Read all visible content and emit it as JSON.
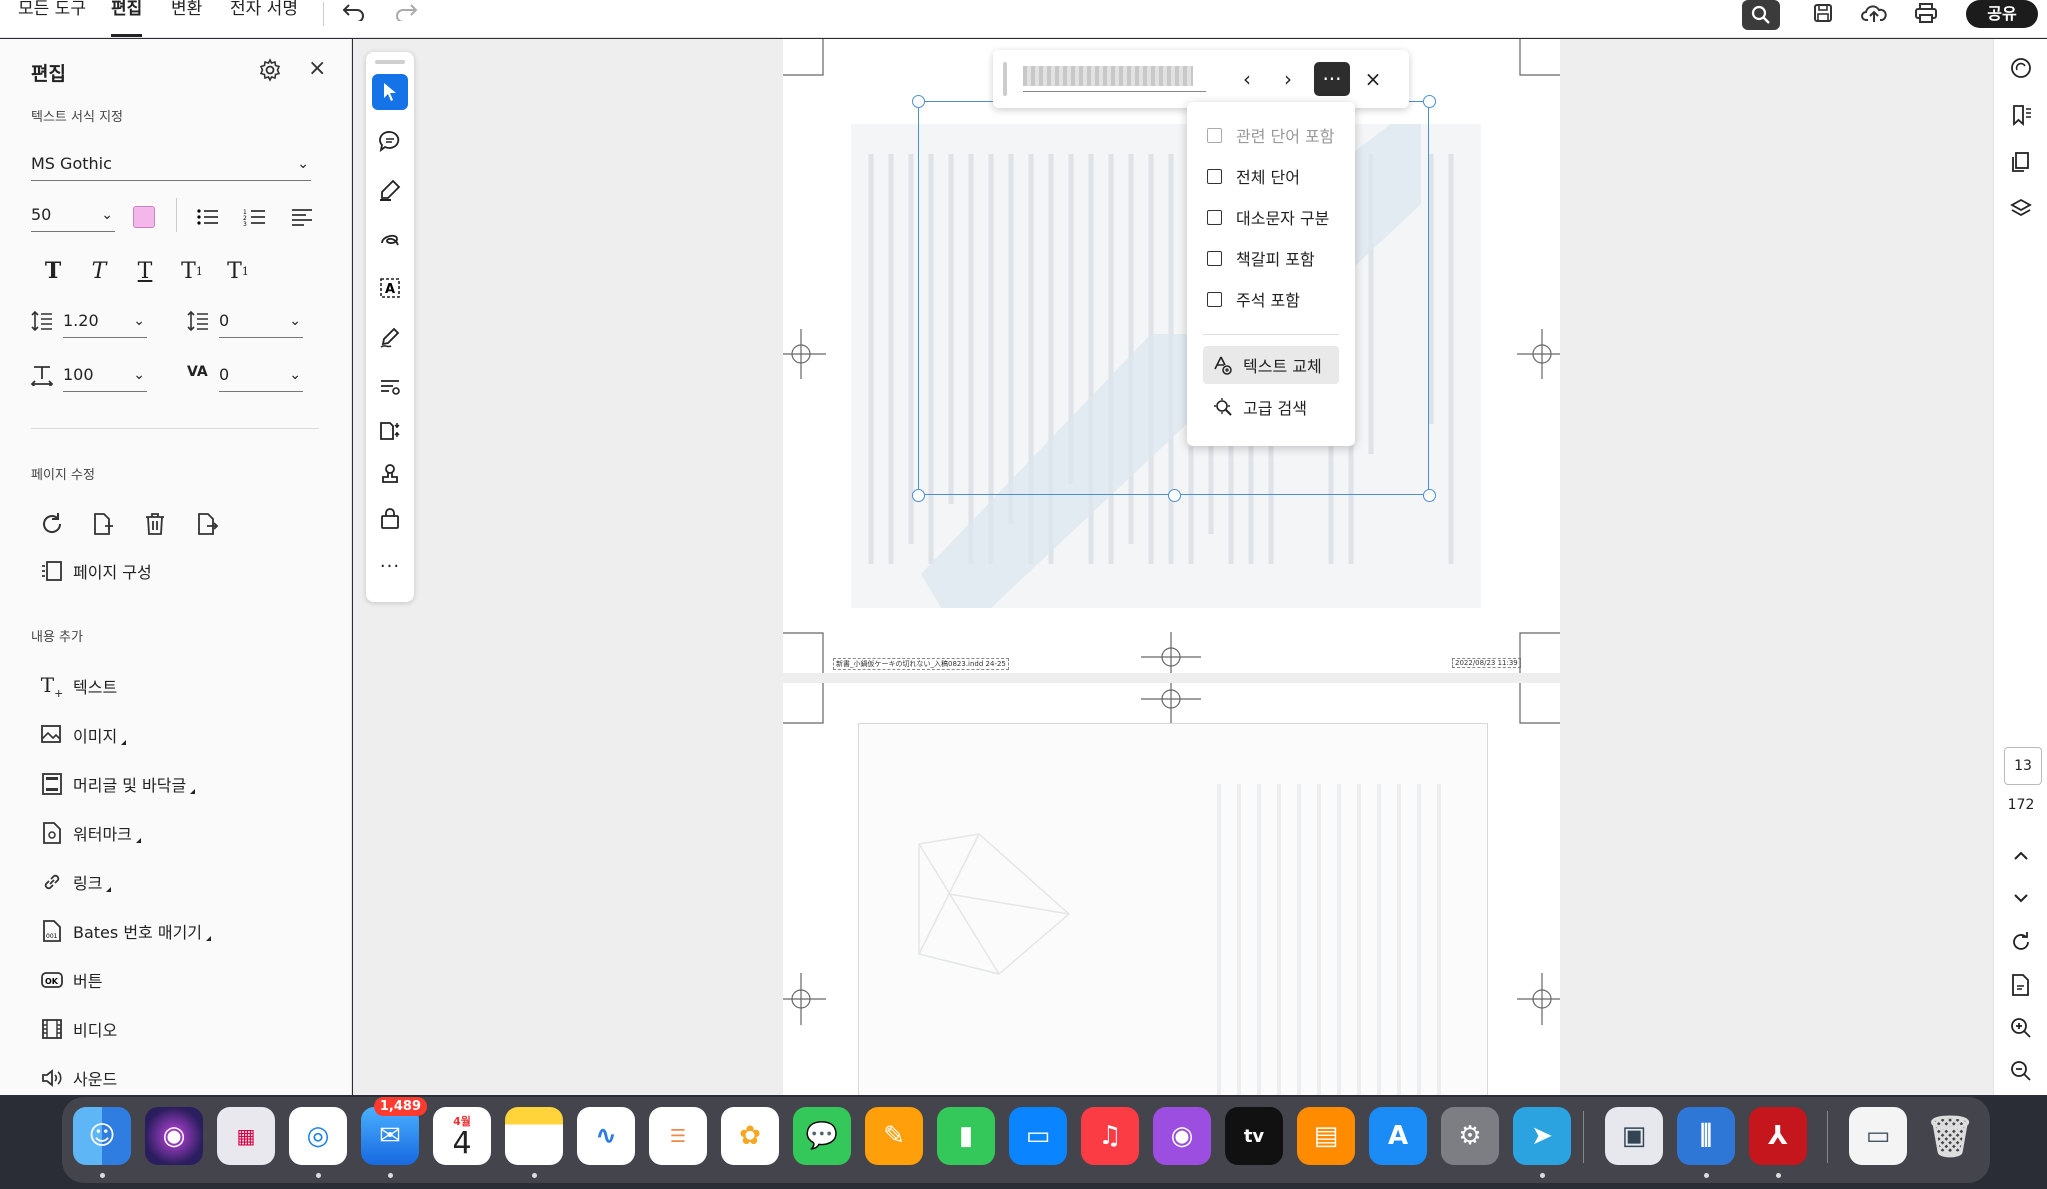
{
  "menubar": {
    "items": [
      {
        "label": "모든 도구",
        "active": false
      },
      {
        "label": "편집",
        "active": true
      },
      {
        "label": "변환",
        "active": false
      },
      {
        "label": "전자 서명",
        "active": false
      }
    ],
    "share_label": "공유",
    "icons": [
      "undo-icon",
      "redo-icon",
      "search-icon",
      "save-icon",
      "cloud-upload-icon",
      "print-icon"
    ]
  },
  "left_panel": {
    "title": "편집",
    "text_format_label": "텍스트 서식 지정",
    "font_family": "MS Gothic",
    "font_size": "50",
    "text_color": "#f5b6ec",
    "line_spacing": "1.20",
    "paragraph_spacing": "0",
    "horizontal_scale": "100",
    "char_spacing": "0",
    "page_edit_label": "페이지 수정",
    "page_organize_label": "페이지 구성",
    "add_content_label": "내용 추가",
    "add_items": [
      {
        "label": "텍스트",
        "icon": "add-text-icon",
        "has_menu": false
      },
      {
        "label": "이미지",
        "icon": "add-image-icon",
        "has_menu": true
      },
      {
        "label": "머리글 및 바닥글",
        "icon": "header-footer-icon",
        "has_menu": true
      },
      {
        "label": "워터마크",
        "icon": "watermark-icon",
        "has_menu": true
      },
      {
        "label": "링크",
        "icon": "link-icon",
        "has_menu": true
      },
      {
        "label": "Bates 번호 매기기",
        "icon": "bates-numbering-icon",
        "has_menu": true
      },
      {
        "label": "버튼",
        "icon": "button-icon",
        "has_menu": false
      },
      {
        "label": "비디오",
        "icon": "video-icon",
        "has_menu": false
      },
      {
        "label": "사운드",
        "icon": "sound-icon",
        "has_menu": false
      }
    ]
  },
  "find_bar": {
    "query": "",
    "prev_label": "‹",
    "next_label": "›",
    "more_label": "···",
    "close_label": "×"
  },
  "find_options": {
    "checkboxes": [
      {
        "label": "관련 단어 포함",
        "checked": false,
        "disabled": true
      },
      {
        "label": "전체 단어",
        "checked": false,
        "disabled": false
      },
      {
        "label": "대소문자 구분",
        "checked": false,
        "disabled": false
      },
      {
        "label": "책갈피 포함",
        "checked": false,
        "disabled": false
      },
      {
        "label": "주석 포함",
        "checked": false,
        "disabled": false
      }
    ],
    "actions": [
      {
        "label": "텍스트 교체",
        "icon": "replace-text-icon",
        "active": true
      },
      {
        "label": "고급 검색",
        "icon": "advanced-search-icon",
        "active": false
      }
    ]
  },
  "page_footer": {
    "left": "新書_小鍋仮ケーキの切れない_入稿0823.indd 24-25",
    "right": "2022/08/23 11:39"
  },
  "right_rail": {
    "current_page": "13",
    "total_pages": "172"
  },
  "dock": {
    "mail_badge": "1,489",
    "calendar_month": "4월",
    "calendar_day": "4",
    "apps": [
      "finder",
      "siri",
      "launchpad",
      "safari",
      "mail",
      "calendar",
      "notes",
      "freeform",
      "reminders",
      "photos",
      "messages",
      "pages",
      "numbers",
      "keynote",
      "music",
      "podcasts",
      "tv",
      "books",
      "app-store",
      "system-settings",
      "telegram",
      "preview",
      "library",
      "acrobat",
      "screenshot",
      "trash"
    ]
  }
}
